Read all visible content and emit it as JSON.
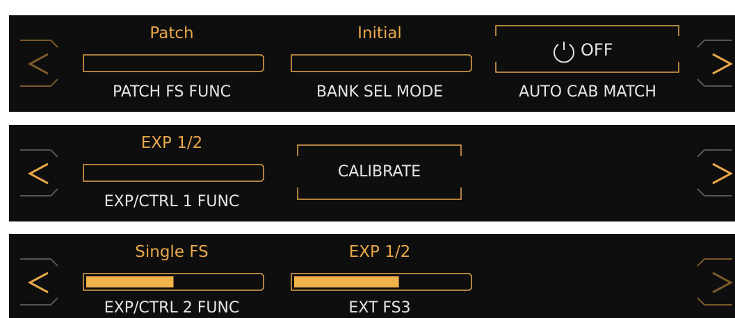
{
  "colors": {
    "accent": "#e8a74a",
    "accent_dim": "#7a5a2a",
    "arrow_dim": "#4a4a4a",
    "panel_bg": "#0e0e0e",
    "text": "#e6e6e6"
  },
  "panels": [
    {
      "left_arrow_active": false,
      "right_arrow_active": true,
      "params": [
        {
          "value": "Patch",
          "label": "PATCH FS FUNC",
          "level": 0
        },
        {
          "value": "Initial",
          "label": "BANK SEL MODE",
          "level": 0
        }
      ],
      "toggle": {
        "icon": "power-icon",
        "state": "OFF",
        "label": "AUTO CAB MATCH"
      }
    },
    {
      "left_arrow_active": true,
      "right_arrow_active": true,
      "params": [
        {
          "value": "EXP 1/2",
          "label": "EXP/CTRL 1 FUNC",
          "level": 0
        }
      ],
      "button": {
        "label": "CALIBRATE"
      }
    },
    {
      "left_arrow_active": true,
      "right_arrow_active": false,
      "params": [
        {
          "value": "Single FS",
          "label": "EXP/CTRL 2 FUNC",
          "level": 0.5
        },
        {
          "value": "EXP 1/2",
          "label": "EXT FS3",
          "level": 0.6
        }
      ]
    }
  ]
}
